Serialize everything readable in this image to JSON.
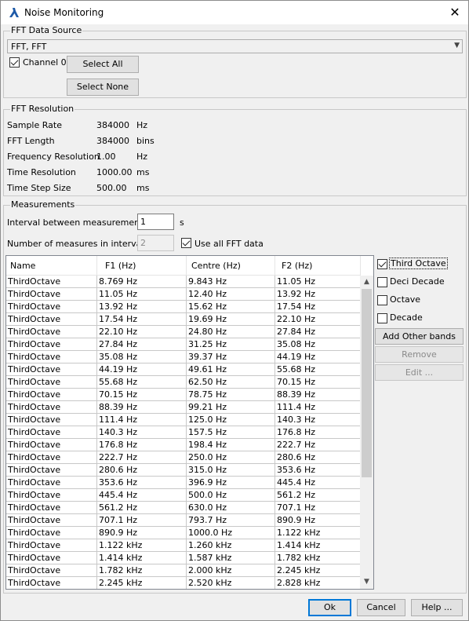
{
  "window": {
    "title": "Noise Monitoring",
    "close_glyph": "✕"
  },
  "source": {
    "group_label": "FFT Data Source",
    "combo_value": "FFT, FFT",
    "channel_label": "Channel 0",
    "channel_checked": true,
    "select_all": "Select All",
    "select_none": "Select None"
  },
  "resolution": {
    "group_label": "FFT Resolution",
    "rows": [
      {
        "label": "Sample Rate",
        "value": "384000",
        "unit": "Hz"
      },
      {
        "label": "FFT Length",
        "value": "384000",
        "unit": "bins"
      },
      {
        "label": "Frequency Resolution",
        "value": "1.00",
        "unit": "Hz"
      },
      {
        "label": "Time Resolution",
        "value": "1000.00",
        "unit": "ms"
      },
      {
        "label": "Time Step Size",
        "value": "500.00",
        "unit": "ms"
      }
    ]
  },
  "measurements": {
    "group_label": "Measurements",
    "interval_label": "Interval between measurements",
    "interval_value": "1",
    "interval_unit": "s",
    "num_label": "Number of measures in interval",
    "num_value": "2",
    "use_all_label": "Use all FFT data",
    "use_all_checked": true,
    "columns": [
      "Name",
      "F1 (Hz)",
      "Centre (Hz)",
      "F2 (Hz)"
    ],
    "rows": [
      [
        "ThirdOctave",
        "8.769 Hz",
        "9.843 Hz",
        "11.05 Hz"
      ],
      [
        "ThirdOctave",
        "11.05 Hz",
        "12.40 Hz",
        "13.92 Hz"
      ],
      [
        "ThirdOctave",
        "13.92 Hz",
        "15.62 Hz",
        "17.54 Hz"
      ],
      [
        "ThirdOctave",
        "17.54 Hz",
        "19.69 Hz",
        "22.10 Hz"
      ],
      [
        "ThirdOctave",
        "22.10 Hz",
        "24.80 Hz",
        "27.84 Hz"
      ],
      [
        "ThirdOctave",
        "27.84 Hz",
        "31.25 Hz",
        "35.08 Hz"
      ],
      [
        "ThirdOctave",
        "35.08 Hz",
        "39.37 Hz",
        "44.19 Hz"
      ],
      [
        "ThirdOctave",
        "44.19 Hz",
        "49.61 Hz",
        "55.68 Hz"
      ],
      [
        "ThirdOctave",
        "55.68 Hz",
        "62.50 Hz",
        "70.15 Hz"
      ],
      [
        "ThirdOctave",
        "70.15 Hz",
        "78.75 Hz",
        "88.39 Hz"
      ],
      [
        "ThirdOctave",
        "88.39 Hz",
        "99.21 Hz",
        "111.4 Hz"
      ],
      [
        "ThirdOctave",
        "111.4 Hz",
        "125.0 Hz",
        "140.3 Hz"
      ],
      [
        "ThirdOctave",
        "140.3 Hz",
        "157.5 Hz",
        "176.8 Hz"
      ],
      [
        "ThirdOctave",
        "176.8 Hz",
        "198.4 Hz",
        "222.7 Hz"
      ],
      [
        "ThirdOctave",
        "222.7 Hz",
        "250.0 Hz",
        "280.6 Hz"
      ],
      [
        "ThirdOctave",
        "280.6 Hz",
        "315.0 Hz",
        "353.6 Hz"
      ],
      [
        "ThirdOctave",
        "353.6 Hz",
        "396.9 Hz",
        "445.4 Hz"
      ],
      [
        "ThirdOctave",
        "445.4 Hz",
        "500.0 Hz",
        "561.2 Hz"
      ],
      [
        "ThirdOctave",
        "561.2 Hz",
        "630.0 Hz",
        "707.1 Hz"
      ],
      [
        "ThirdOctave",
        "707.1 Hz",
        "793.7 Hz",
        "890.9 Hz"
      ],
      [
        "ThirdOctave",
        "890.9 Hz",
        "1000.0 Hz",
        "1.122 kHz"
      ],
      [
        "ThirdOctave",
        "1.122 kHz",
        "1.260 kHz",
        "1.414 kHz"
      ],
      [
        "ThirdOctave",
        "1.414 kHz",
        "1.587 kHz",
        "1.782 kHz"
      ],
      [
        "ThirdOctave",
        "1.782 kHz",
        "2.000 kHz",
        "2.245 kHz"
      ],
      [
        "ThirdOctave",
        "2.245 kHz",
        "2.520 kHz",
        "2.828 kHz"
      ]
    ],
    "bands": [
      {
        "label": "Third Octave",
        "checked": true
      },
      {
        "label": "Deci Decade",
        "checked": false
      },
      {
        "label": "Octave",
        "checked": false
      },
      {
        "label": "Decade",
        "checked": false
      }
    ],
    "add_other": "Add Other bands",
    "remove": "Remove",
    "edit": "Edit ..."
  },
  "footer": {
    "ok": "Ok",
    "cancel": "Cancel",
    "help": "Help ..."
  },
  "colors": {
    "accent": "#0078d7",
    "icon": "#1e5aa8"
  }
}
